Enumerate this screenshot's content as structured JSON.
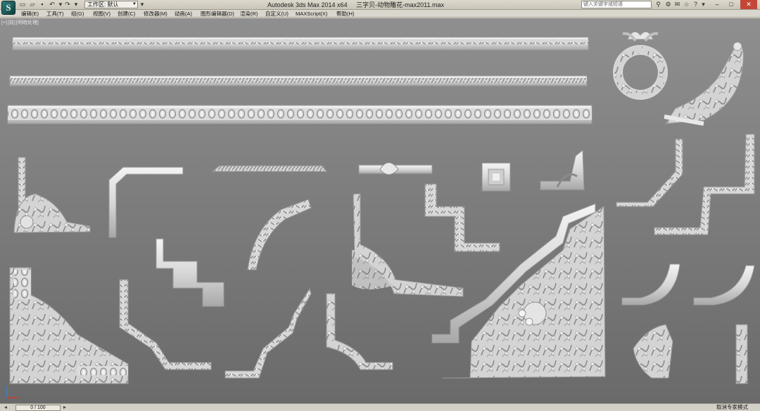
{
  "window": {
    "app_name": "Autodesk 3ds Max  2014 x64",
    "file_name": "三字贝-动物雕花-max2011.max",
    "workspace_label": "工作区: 默认",
    "search_placeholder": "键入关键字或短语"
  },
  "menu": [
    "编辑(E)",
    "工具(T)",
    "组(G)",
    "视图(V)",
    "创建(C)",
    "修改器(M)",
    "动画(A)",
    "图形编辑器(D)",
    "渲染(R)",
    "自定义(U)",
    "MAXScript(X)",
    "帮助(H)"
  ],
  "viewport": {
    "label_parts": [
      "[+]",
      "[前]",
      "[明暗处理]"
    ]
  },
  "status": {
    "frame_counter": "0 / 100",
    "right_text": "取消专家模式"
  },
  "colors": {
    "viewport_top": "#8f8f8f",
    "viewport_bottom": "#6a6a6a",
    "model": "#e4e4e4",
    "model_shadow": "#9a9a9a"
  },
  "icons": {
    "logo": "3ds-max-logo",
    "new": "new-file-icon",
    "open": "open-folder-icon",
    "save": "save-icon",
    "undo": "undo-icon",
    "redo": "redo-icon",
    "search": "binoculars-icon",
    "help": "help-icon"
  }
}
